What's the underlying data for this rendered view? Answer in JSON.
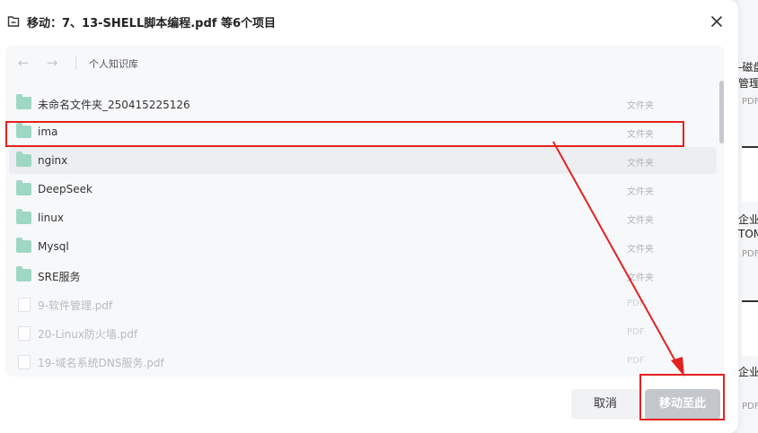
{
  "dialog": {
    "title": "移动：7、13-SHELL脚本编程.pdf 等6个项目",
    "breadcrumb": "个人知识库"
  },
  "items": [
    {
      "name": "未命名文件夹_250415225126",
      "type": "文件夹",
      "kind": "folder",
      "enabled": true
    },
    {
      "name": "ima",
      "type": "文件夹",
      "kind": "folder",
      "enabled": true
    },
    {
      "name": "nginx",
      "type": "文件夹",
      "kind": "folder",
      "enabled": true
    },
    {
      "name": "DeepSeek",
      "type": "文件夹",
      "kind": "folder",
      "enabled": true
    },
    {
      "name": "linux",
      "type": "文件夹",
      "kind": "folder",
      "enabled": true
    },
    {
      "name": "Mysql",
      "type": "文件夹",
      "kind": "folder",
      "enabled": true
    },
    {
      "name": "SRE服务",
      "type": "文件夹",
      "kind": "folder",
      "enabled": true
    },
    {
      "name": "9-软件管理.pdf",
      "type": "PDF",
      "kind": "file",
      "enabled": false
    },
    {
      "name": "20-Linux防火墙.pdf",
      "type": "PDF",
      "kind": "file",
      "enabled": false
    },
    {
      "name": "19-域名系统DNS服务.pdf",
      "type": "PDF",
      "kind": "file",
      "enabled": false
    }
  ],
  "footer": {
    "cancel_label": "取消",
    "move_label": "移动至此"
  },
  "background": {
    "snippets": [
      "-磁盘",
      "管理",
      "PDF",
      "企业",
      "TOM",
      "PDF",
      "企业",
      "PDF"
    ]
  },
  "colors": {
    "annotation": "#e5211f",
    "folder": "#9fd7c5",
    "move_button_disabled": "#c3c6cb"
  }
}
